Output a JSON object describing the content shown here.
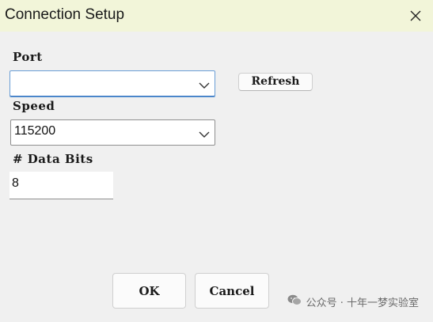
{
  "window": {
    "title": "Connection Setup",
    "titlebar_color": "#f2f5d9"
  },
  "icons": {
    "close": "close-icon",
    "dropdown": "chevron-down-icon",
    "watermark_logo": "wechat-icon"
  },
  "port": {
    "label": "Port",
    "value": ""
  },
  "refresh_button": {
    "label": "Refresh"
  },
  "speed": {
    "label": "Speed",
    "value": "115200"
  },
  "data_bits": {
    "label": "# Data Bits",
    "value": "8"
  },
  "buttons": {
    "ok_label": "OK",
    "cancel_label": "Cancel"
  },
  "watermark": {
    "text": "公众号 · 十年一梦实验室"
  }
}
